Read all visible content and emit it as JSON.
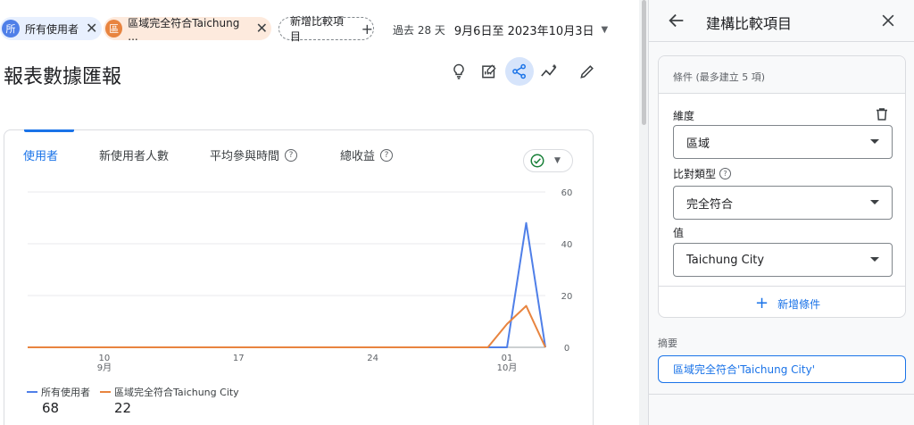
{
  "comparisons": {
    "chips": [
      {
        "badge": "所",
        "label": "所有使用者",
        "color": "#4f7fe8"
      },
      {
        "badge": "區",
        "label": "區域完全符合Taichung ...",
        "color": "#e8843f"
      }
    ],
    "add_label": "新增比較項目"
  },
  "date_range": {
    "prefix": "過去 28 天",
    "range": "9月6日至 2023年10月3日"
  },
  "page_title": "報表數據匯報",
  "toolbar_icons": [
    "lightbulb-icon",
    "edit-report-icon",
    "share-icon",
    "compare-trend-icon",
    "pencil-icon"
  ],
  "metric_tabs": [
    {
      "label": "使用者",
      "active": true,
      "help": false
    },
    {
      "label": "新使用者人數",
      "active": false,
      "help": false
    },
    {
      "label": "平均參與時間",
      "active": false,
      "help": true
    },
    {
      "label": "總收益",
      "active": false,
      "help": true
    }
  ],
  "help_glyph": "?",
  "chart_data": {
    "type": "line",
    "x_ticks": [
      {
        "day": "10",
        "month": "9月"
      },
      {
        "day": "17",
        "month": ""
      },
      {
        "day": "24",
        "month": ""
      },
      {
        "day": "01",
        "month": "10月"
      }
    ],
    "y_ticks": [
      60,
      40,
      20,
      0
    ],
    "ylim": [
      0,
      60
    ],
    "grid": true,
    "legend_position": "bottom-left",
    "x_dates": [
      "9/6",
      "9/7",
      "9/8",
      "9/9",
      "9/10",
      "9/11",
      "9/12",
      "9/13",
      "9/14",
      "9/15",
      "9/16",
      "9/17",
      "9/18",
      "9/19",
      "9/20",
      "9/21",
      "9/22",
      "9/23",
      "9/24",
      "9/25",
      "9/26",
      "9/27",
      "9/28",
      "9/29",
      "9/30",
      "10/1",
      "10/2",
      "10/3"
    ],
    "series": [
      {
        "name": "所有使用者",
        "total": "68",
        "color": "#4f7fe8",
        "values": [
          0,
          0,
          0,
          0,
          0,
          0,
          0,
          0,
          0,
          0,
          0,
          0,
          0,
          0,
          0,
          0,
          0,
          0,
          0,
          0,
          0,
          0,
          0,
          0,
          0,
          0,
          48,
          0
        ]
      },
      {
        "name": "區域完全符合Taichung City",
        "total": "22",
        "color": "#e8843f",
        "values": [
          0,
          0,
          0,
          0,
          0,
          0,
          0,
          0,
          0,
          0,
          0,
          0,
          0,
          0,
          0,
          0,
          0,
          0,
          0,
          0,
          0,
          0,
          0,
          0,
          0,
          9,
          16,
          0
        ]
      }
    ]
  },
  "panel": {
    "title": "建構比較項目",
    "conditions_title": "條件 (最多建立 5 項)",
    "dimension_label": "維度",
    "dimension_value": "區域",
    "match_type_label": "比對類型",
    "match_type_value": "完全符合",
    "value_label": "值",
    "value_value": "Taichung City",
    "add_condition": "新增條件",
    "summary_label": "摘要",
    "summary_value": "區域完全符合'Taichung City'"
  }
}
